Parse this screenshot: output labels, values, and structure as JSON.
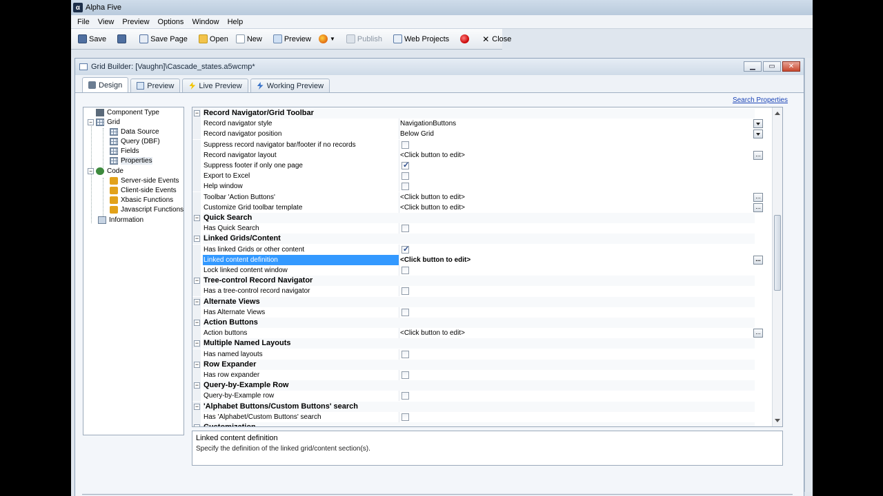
{
  "app": {
    "title": "Alpha Five"
  },
  "menu": [
    "File",
    "View",
    "Preview",
    "Options",
    "Window",
    "Help"
  ],
  "toolbar": {
    "save": "Save",
    "save_page": "Save Page",
    "open": "Open",
    "new": "New",
    "preview": "Preview",
    "publish": "Publish",
    "web_projects": "Web Projects",
    "close": "Close"
  },
  "builder": {
    "title": "Grid Builder: [Vaughn]\\Cascade_states.a5wcmp*",
    "tabs": [
      "Design",
      "Preview",
      "Live Preview",
      "Working Preview"
    ],
    "search_link": "Search Properties"
  },
  "tree": {
    "component_type": "Component Type",
    "grid": "Grid",
    "data_source": "Data Source",
    "query": "Query (DBF)",
    "fields": "Fields",
    "properties": "Properties",
    "code": "Code",
    "server_events": "Server-side Events",
    "client_events": "Client-side Events",
    "xbasic": "Xbasic Functions",
    "javascript": "Javascript Functions",
    "information": "Information"
  },
  "rows": [
    {
      "type": "section",
      "name": "Record Navigator/Grid Toolbar"
    },
    {
      "type": "prop",
      "name": "Record navigator style",
      "value": "NavigationButtons",
      "ctrl": "dd"
    },
    {
      "type": "prop",
      "name": "Record navigator position",
      "value": "Below Grid",
      "ctrl": "dd"
    },
    {
      "type": "prop",
      "name": "Suppress record navigator bar/footer if no records",
      "ctrl": "cb",
      "checked": false
    },
    {
      "type": "prop",
      "name": "Record navigator layout",
      "value": "<Click button to edit>",
      "ctrl": "ell"
    },
    {
      "type": "prop",
      "name": "Suppress footer if only one page",
      "ctrl": "cb",
      "checked": true
    },
    {
      "type": "prop",
      "name": "Export to Excel",
      "ctrl": "cb",
      "checked": false
    },
    {
      "type": "prop",
      "name": "Help window",
      "ctrl": "cb",
      "checked": false
    },
    {
      "type": "prop",
      "name": "Toolbar 'Action Buttons'",
      "value": "<Click button to edit>",
      "ctrl": "ell"
    },
    {
      "type": "prop",
      "name": "Customize Grid toolbar template",
      "value": "<Click button to edit>",
      "ctrl": "ell"
    },
    {
      "type": "section",
      "name": "Quick Search"
    },
    {
      "type": "prop",
      "name": "Has Quick Search",
      "ctrl": "cb",
      "checked": false
    },
    {
      "type": "section",
      "name": "Linked Grids/Content"
    },
    {
      "type": "prop",
      "name": "Has linked Grids or other content",
      "ctrl": "cb",
      "checked": true
    },
    {
      "type": "prop",
      "name": "Linked content definition",
      "value": "<Click button to edit>",
      "ctrl": "ell",
      "selected": true
    },
    {
      "type": "prop",
      "name": "Lock linked content window",
      "ctrl": "cb",
      "checked": false
    },
    {
      "type": "section",
      "name": "Tree-control Record Navigator"
    },
    {
      "type": "prop",
      "name": "Has a tree-control record navigator",
      "ctrl": "cb",
      "checked": false
    },
    {
      "type": "section",
      "name": "Alternate Views"
    },
    {
      "type": "prop",
      "name": "Has Alternate Views",
      "ctrl": "cb",
      "checked": false
    },
    {
      "type": "section",
      "name": "Action Buttons"
    },
    {
      "type": "prop",
      "name": "Action buttons",
      "value": "<Click button to edit>",
      "ctrl": "ell"
    },
    {
      "type": "section",
      "name": "Multiple Named Layouts"
    },
    {
      "type": "prop",
      "name": "Has named layouts",
      "ctrl": "cb",
      "checked": false
    },
    {
      "type": "section",
      "name": "Row Expander"
    },
    {
      "type": "prop",
      "name": "Has row expander",
      "ctrl": "cb",
      "checked": false
    },
    {
      "type": "section",
      "name": "Query-by-Example Row"
    },
    {
      "type": "prop",
      "name": "Query-by-Example row",
      "ctrl": "cb",
      "checked": false
    },
    {
      "type": "section",
      "name": "'Alphabet Buttons/Custom Buttons' search"
    },
    {
      "type": "prop",
      "name": "Has 'Alphabet/Custom Buttons' search",
      "ctrl": "cb",
      "checked": false
    },
    {
      "type": "section",
      "name": "Customization"
    }
  ],
  "description": {
    "title": "Linked content definition",
    "text": "Specify the definition of the linked grid/content section(s)."
  }
}
